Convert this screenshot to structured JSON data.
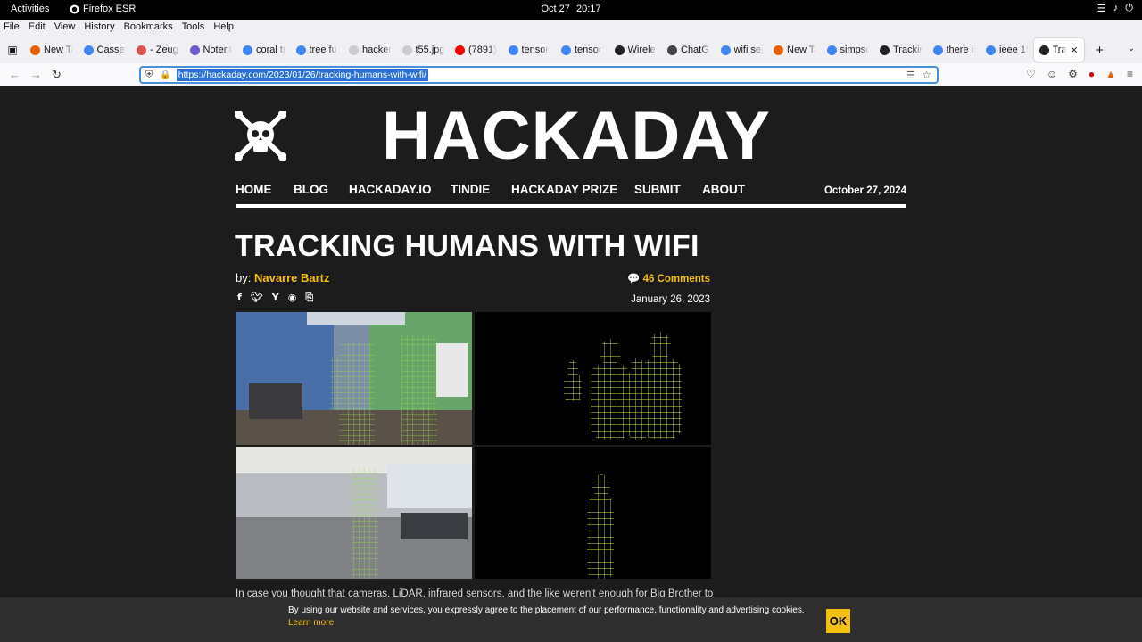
{
  "system_bar": {
    "activities": "Activities",
    "app_name": "Firefox ESR",
    "date": "Oct 27",
    "time": "20:17"
  },
  "menu": [
    "File",
    "Edit",
    "View",
    "History",
    "Bookmarks",
    "Tools",
    "Help"
  ],
  "tabs": [
    {
      "title": "New Tab",
      "favicon_color": "#e66000"
    },
    {
      "title": "Cassette",
      "favicon_color": "#4285f4"
    },
    {
      "title": "- Zeug",
      "favicon_color": "#d9534f"
    },
    {
      "title": "Notent",
      "favicon_color": "#6a5acd"
    },
    {
      "title": "coral tp",
      "favicon_color": "#4285f4"
    },
    {
      "title": "tree fu",
      "favicon_color": "#4285f4"
    },
    {
      "title": "hackersca",
      "favicon_color": "#cccccc"
    },
    {
      "title": "t55.jpg (JP",
      "favicon_color": "#cccccc"
    },
    {
      "title": "(7891)",
      "favicon_color": "#ff0000"
    },
    {
      "title": "tensor",
      "favicon_color": "#4285f4"
    },
    {
      "title": "tensor",
      "favicon_color": "#4285f4"
    },
    {
      "title": "Wireless",
      "favicon_color": "#222222"
    },
    {
      "title": "ChatGI",
      "favicon_color": "#444444"
    },
    {
      "title": "wifi ser",
      "favicon_color": "#4285f4"
    },
    {
      "title": "New Tab",
      "favicon_color": "#e66000"
    },
    {
      "title": "simpso",
      "favicon_color": "#4285f4"
    },
    {
      "title": "Tracking",
      "favicon_color": "#222222"
    },
    {
      "title": "there is",
      "favicon_color": "#4285f4"
    },
    {
      "title": "ieee 15",
      "favicon_color": "#4285f4"
    },
    {
      "title": "Trac",
      "favicon_color": "#222222",
      "active": true
    }
  ],
  "address_bar": {
    "url": "https://hackaday.com/2023/01/26/tracking-humans-with-wifi/"
  },
  "site": {
    "name": "HACKADAY",
    "nav": [
      "HOME",
      "BLOG",
      "HACKADAY.IO",
      "TINDIE",
      "HACKADAY PRIZE",
      "SUBMIT",
      "ABOUT"
    ],
    "today": "October 27, 2024"
  },
  "article": {
    "title": "TRACKING HUMANS WITH WIFI",
    "by_label": "by:",
    "author": "Navarre Bartz",
    "comments": "46 Comments",
    "date": "January 26, 2023",
    "excerpt": "In case you thought that cameras, LiDAR, infrared sensors, and the like weren't enough for Big Brother to"
  },
  "cookie_banner": {
    "message": "By using our website and services, you expressly agree to the placement of our performance, functionality and advertising cookies.",
    "learn_more": "Learn more",
    "ok": "OK"
  },
  "colors": {
    "accent": "#f3bf10",
    "page_bg": "#1c1c1c"
  }
}
